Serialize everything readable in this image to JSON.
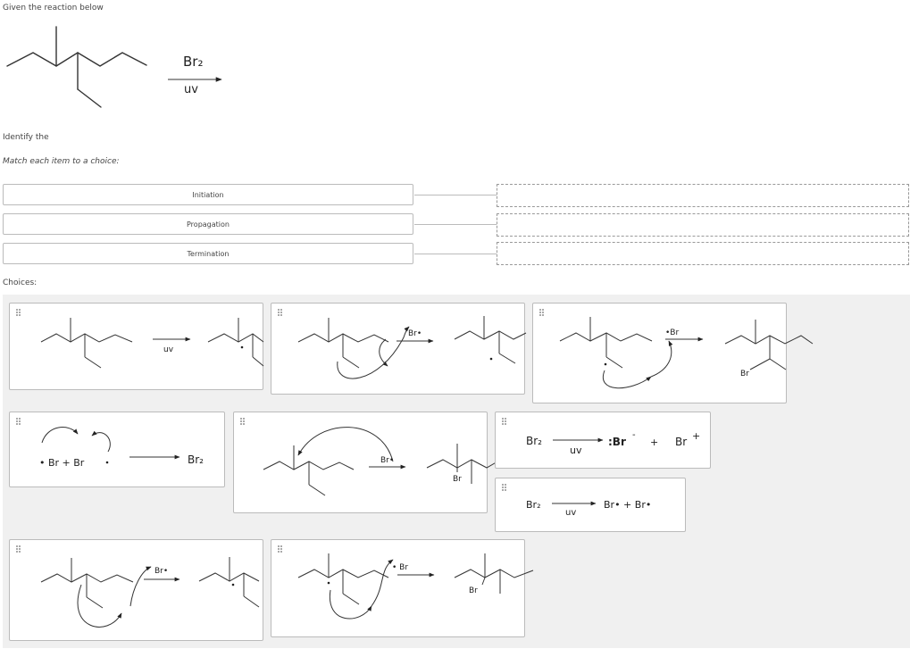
{
  "header": {
    "prompt": "Given the reaction below",
    "reagent_top": "Br₂",
    "reagent_bottom": "uv"
  },
  "identify_text": "Identify the",
  "match_instruction": "Match each item to a choice:",
  "items": [
    {
      "label": "Initiation"
    },
    {
      "label": "Propagation"
    },
    {
      "label": "Termination"
    }
  ],
  "choices_label": "Choices:",
  "choices": {
    "c1": {
      "reagent": "uv"
    },
    "c2": {
      "radical": "Br•"
    },
    "c3": {
      "radical": "•Br",
      "product_sub": "Br"
    },
    "c4": {
      "left": "• Br + Br",
      "product": "Br₂"
    },
    "c5": {
      "radical": "Br•",
      "product_sub": "Br"
    },
    "c6": {
      "reactant": "Br₂",
      "condition": "uv",
      "product1": ":Br",
      "charge1": "-",
      "plus": "+",
      "product2": "Br",
      "charge2": "+"
    },
    "c7": {
      "reactant": "Br₂",
      "condition": "uv",
      "products": "Br• + Br•"
    },
    "c8": {
      "radical": "Br•"
    },
    "c9": {
      "radical": "• Br",
      "product_sub": "Br"
    }
  },
  "colors": {
    "choices_bg": "#f0f0f0",
    "border": "#bbbbbb",
    "text": "#333333"
  }
}
